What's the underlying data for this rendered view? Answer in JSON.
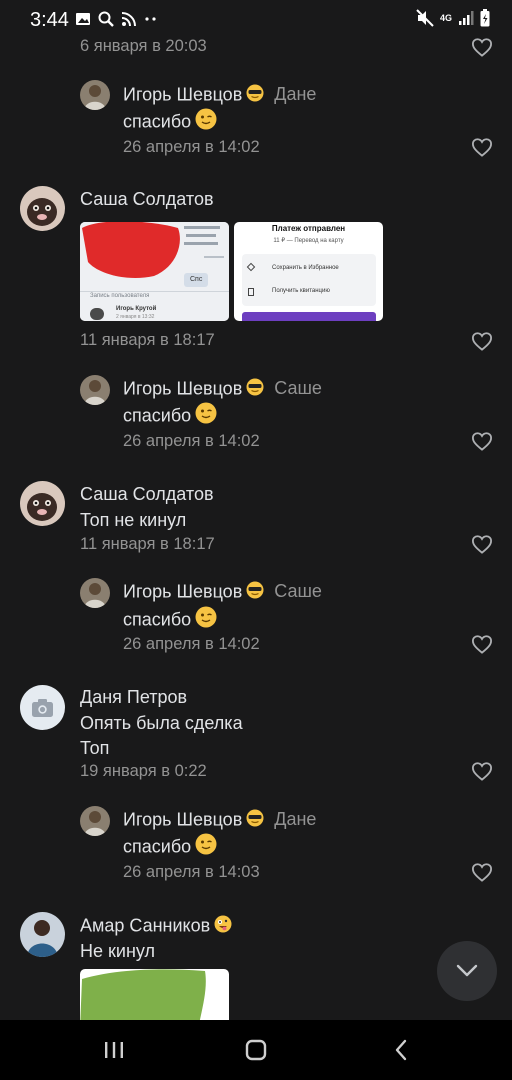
{
  "status_bar": {
    "time": "3:44",
    "left_icons": [
      "gallery-icon",
      "search-icon",
      "rss-icon",
      "more-dots-icon"
    ],
    "right_icons": [
      "mute-icon",
      "network-4g-icon",
      "signal-icon",
      "battery-icon"
    ],
    "network_label": "4G"
  },
  "comments": [
    {
      "kind": "partial",
      "date": "6 января в 20:03"
    },
    {
      "kind": "reply",
      "author": "Игорь Шевцов",
      "author_emoji": "😎",
      "reply_to": "Дане",
      "text": "спасибо",
      "text_emoji": "😉",
      "date": "26 апреля в 14:02"
    },
    {
      "kind": "comment",
      "author": "Саша Солдатов",
      "date": "11 января в 18:17",
      "attachments": [
        {
          "type": "screenshot",
          "mini_texts": [
            "Спс",
            "Запись пользователя",
            "Игорь Крутой",
            "2 января в 13:32"
          ]
        },
        {
          "type": "screenshot",
          "title": "Платеж отправлен",
          "subtitle": "11 ₽ — Перевод на карту",
          "items": [
            "Сохранить в Избранное",
            "Получить квитанцию"
          ]
        }
      ]
    },
    {
      "kind": "reply",
      "author": "Игорь Шевцов",
      "author_emoji": "😎",
      "reply_to": "Саше",
      "text": "спасибо",
      "text_emoji": "😉",
      "date": "26 апреля в 14:02"
    },
    {
      "kind": "comment",
      "author": "Саша Солдатов",
      "text": "Топ не кинул",
      "date": "11 января в 18:17"
    },
    {
      "kind": "reply",
      "author": "Игорь Шевцов",
      "author_emoji": "😎",
      "reply_to": "Саше",
      "text": "спасибо",
      "text_emoji": "😉",
      "date": "26 апреля в 14:02"
    },
    {
      "kind": "comment",
      "author": "Даня Петров",
      "text_lines": [
        "Опять была сделка",
        "Топ"
      ],
      "date": "19 января в 0:22"
    },
    {
      "kind": "reply",
      "author": "Игорь Шевцов",
      "author_emoji": "😎",
      "reply_to": "Дане",
      "text": "спасибо",
      "text_emoji": "😉",
      "date": "26 апреля в 14:03"
    },
    {
      "kind": "comment",
      "author": "Амар Санников",
      "author_emoji": "🤪",
      "text": "Не кинул"
    }
  ],
  "colors": {
    "background": "#19191a",
    "text_primary": "#e1e3e6",
    "text_secondary": "#939393",
    "fab_background": "#2f3033",
    "navbar_background": "#000000"
  },
  "scroll_button": {
    "icon": "chevron-down-icon"
  },
  "nav_bar": {
    "buttons": [
      "recent-apps-icon",
      "home-icon",
      "back-icon"
    ]
  }
}
